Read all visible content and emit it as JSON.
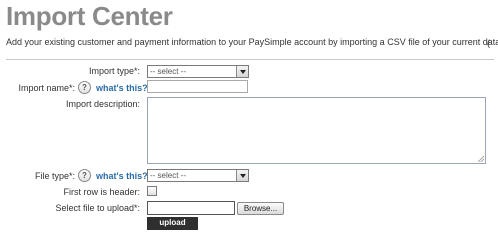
{
  "page": {
    "title": "Import Center",
    "intro": "Add your existing customer and payment information to your PaySimple account by importing a CSV file of your current data.",
    "intro_trailing_mark": "(",
    "colors": {
      "title": "#8a8a8a",
      "link": "#2a6da8",
      "upload_button_bg": "#2f2f2f"
    }
  },
  "form": {
    "import_type": {
      "label": "Import type*:",
      "selected": "-- select --"
    },
    "import_name": {
      "label": "Import name*:",
      "help_icon": "?",
      "help_link": "what's this?",
      "value": ""
    },
    "import_description": {
      "label": "Import description:",
      "value": ""
    },
    "file_type": {
      "label": "File type*:",
      "help_icon": "?",
      "help_link": "what's this?",
      "selected": "-- select --"
    },
    "first_row_header": {
      "label": "First row is header:",
      "checked": false
    },
    "file_upload": {
      "label": "Select file to upload*:",
      "value": "",
      "browse_label": "Browse..."
    },
    "upload_label": "upload"
  },
  "icons": {
    "help": "question-circle-icon",
    "dropdown": "chevron-down-icon",
    "resize": "resize-grip-icon"
  }
}
